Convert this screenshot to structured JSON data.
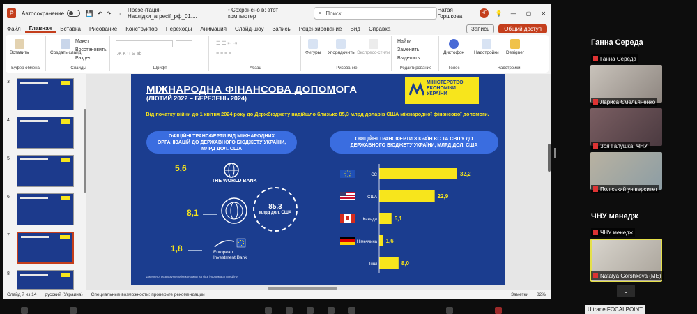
{
  "titlebar": {
    "autosave": "Автосохранение",
    "filename": "Презентація-Наслідки_агресії_рф_01....",
    "saved": "• Сохранено в: этот компьютер",
    "search_placeholder": "Поиск",
    "user": "Натая Горшкова",
    "initials": "НГ"
  },
  "menu": [
    "Файл",
    "Главная",
    "Вставка",
    "Рисование",
    "Конструктор",
    "Переходы",
    "Анимация",
    "Слайд-шоу",
    "Запись",
    "Рецензирование",
    "Вид",
    "Справка"
  ],
  "menu_right": {
    "record": "Запись",
    "share": "Общий доступ"
  },
  "ribbon": {
    "paste": "Вставить",
    "create_slide": "Создать слайд",
    "layout": "Макет",
    "reset": "Восстановить",
    "section": "Раздел",
    "shapes": "Фигуры",
    "arrange": "Упорядочить",
    "express": "Экспресс-стили",
    "find": "Найти",
    "replace": "Заменить",
    "select": "Выделить",
    "dictation": "Диктофон",
    "addins": "Надстройки",
    "designer": "Designer",
    "groups": [
      "Буфер обмена",
      "Слайды",
      "Шрифт",
      "Абзац",
      "Рисование",
      "Редактирование",
      "Голос",
      "Надстройки"
    ]
  },
  "thumbs": [
    "3",
    "4",
    "5",
    "6",
    "7",
    "8"
  ],
  "slide": {
    "title": "МІЖНАРОДНА ФІНАНСОВА ДОПОМОГА",
    "subtitle": "(ЛЮТИЙ 2022 – БЕРЕЗЕНЬ 2024)",
    "ministry": [
      "МІНІСТЕРСТВО",
      "ЕКОНОМІКИ",
      "УКРАЇНИ"
    ],
    "intro": "Від початку війни до 1 квітня 2024 року до Держбюджету надійшло близько 85,3 млрд доларів США міжнародної фінансової допомоги.",
    "pill_left": "ОФІЦІЙНІ ТРАНСФЕРТИ ВІД МІЖНАРОДНИХ ОРГАНІЗАЦІЙ ДО ДЕРЖАВНОГО БЮДЖЕТУ УКРАЇНИ, МЛРД ДОЛ. США",
    "pill_right": "ОФІЦІЙНІ ТРАНСФЕРТИ З КРАЇН ЄС ТА СВІТУ ДО ДЕРЖАВНОГО БЮДЖЕТУ УКРАЇНИ, МЛРД ДОЛ. США",
    "wb_value": "5,6",
    "wb_label": "THE WORLD BANK",
    "imf_value": "8,1",
    "eib_value": "1,8",
    "eib_label": "European Investment Bank",
    "total_value": "85,3",
    "total_unit": "млрд дол. США",
    "footnote": "Джерело: розрахунки Мінекономіки на базі інформації Мінфіну"
  },
  "chart_data": {
    "type": "bar",
    "orientation": "horizontal",
    "categories": [
      "ЄС",
      "США",
      "Канада",
      "Німеччина",
      "Інші"
    ],
    "values": [
      32.2,
      22.9,
      5.1,
      1.6,
      8.0
    ],
    "value_labels": [
      "32,2",
      "22,9",
      "5,1",
      "1,6",
      "8,0"
    ],
    "title": "",
    "xlabel": "",
    "ylabel": "",
    "xlim": [
      0,
      32.2
    ],
    "bar_color": "#f7e51c"
  },
  "status": {
    "slide": "Слайд 7 из 14",
    "lang": "русский (Украина)",
    "access": "Специальные возможности: проверьте рекомендации",
    "notes": "Заметки",
    "zoom": "82%"
  },
  "participants": [
    {
      "big": "Ганна Середа",
      "name": "Ганна Середа"
    },
    {
      "name": "Лариса Ємельяненко"
    },
    {
      "name": "Зоя Галушка, ЧНУ"
    },
    {
      "name": "Поліський університет"
    },
    {
      "big": "ЧНУ менедж",
      "name": "ЧНУ менедж"
    },
    {
      "name": "Natalya Gorshkova (МЕ)"
    }
  ],
  "bottom": {
    "tag": "UltranetFOCALPOINT"
  }
}
